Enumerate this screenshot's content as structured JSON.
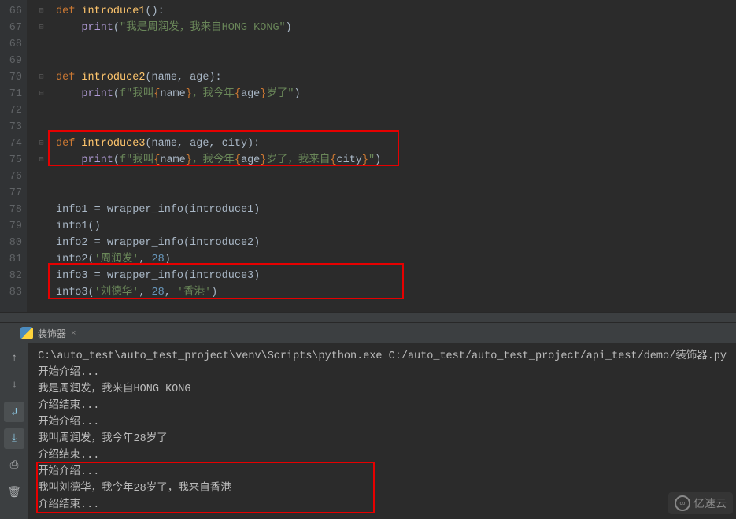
{
  "editor": {
    "lines": [
      "66",
      "67",
      "68",
      "69",
      "70",
      "71",
      "72",
      "73",
      "74",
      "75",
      "76",
      "77",
      "78",
      "79",
      "80",
      "81",
      "82",
      "83"
    ]
  },
  "code": {
    "l66_def": "def ",
    "l66_fn": "introduce1",
    "l66_end": "():",
    "l67_print": "print",
    "l67_p1": "(",
    "l67_str": "\"我是周润发，我来自HONG KONG\"",
    "l67_p2": ")",
    "l70_def": "def ",
    "l70_fn": "introduce2",
    "l70_sig": "(name, age):",
    "l71_print": "print",
    "l71_p1": "(",
    "l71_f": "f\"我叫",
    "l71_b1": "{",
    "l71_v1": "name",
    "l71_b2": "}",
    "l71_m1": "，我今年",
    "l71_b3": "{",
    "l71_v2": "age",
    "l71_b4": "}",
    "l71_m2": "岁了\"",
    "l71_p2": ")",
    "l74_def": "def ",
    "l74_fn": "introduce3",
    "l74_sig": "(name, age, city):",
    "l75_print": "print",
    "l75_p1": "(",
    "l75_f": "f\"我叫",
    "l75_b1": "{",
    "l75_v1": "name",
    "l75_b2": "}",
    "l75_m1": "，我今年",
    "l75_b3": "{",
    "l75_v2": "age",
    "l75_b4": "}",
    "l75_m2": "岁了，我来自",
    "l75_b5": "{",
    "l75_v3": "city",
    "l75_b6": "}",
    "l75_m3": "\"",
    "l75_p2": ")",
    "l78_a": "info1 = ",
    "l78_fn": "wrapper_info",
    "l78_b": "(introduce1)",
    "l79": "info1()",
    "l80_a": "info2 = ",
    "l80_fn": "wrapper_info",
    "l80_b": "(introduce2)",
    "l81_a": "info2(",
    "l81_s": "'周润发'",
    "l81_c": ", ",
    "l81_n": "28",
    "l81_e": ")",
    "l82_a": "info3 = ",
    "l82_fn": "wrapper_info",
    "l82_b": "(introduce3)",
    "l83_a": "info3(",
    "l83_s1": "'刘德华'",
    "l83_c1": ", ",
    "l83_n": "28",
    "l83_c2": ", ",
    "l83_s2": "'香港'",
    "l83_e": ")"
  },
  "runtab": {
    "label": "装饰器",
    "close": "×"
  },
  "console": {
    "l0": "C:\\auto_test\\auto_test_project\\venv\\Scripts\\python.exe C:/auto_test/auto_test_project/api_test/demo/装饰器.py",
    "l1": "开始介绍...",
    "l2": "我是周润发，我来自HONG KONG",
    "l3": "介绍结束...",
    "l4": "开始介绍...",
    "l5": "我叫周润发，我今年28岁了",
    "l6": "介绍结束...",
    "l7": "开始介绍...",
    "l8": "我叫刘德华，我今年28岁了，我来自香港",
    "l9": "介绍结束..."
  },
  "watermark": "亿速云"
}
